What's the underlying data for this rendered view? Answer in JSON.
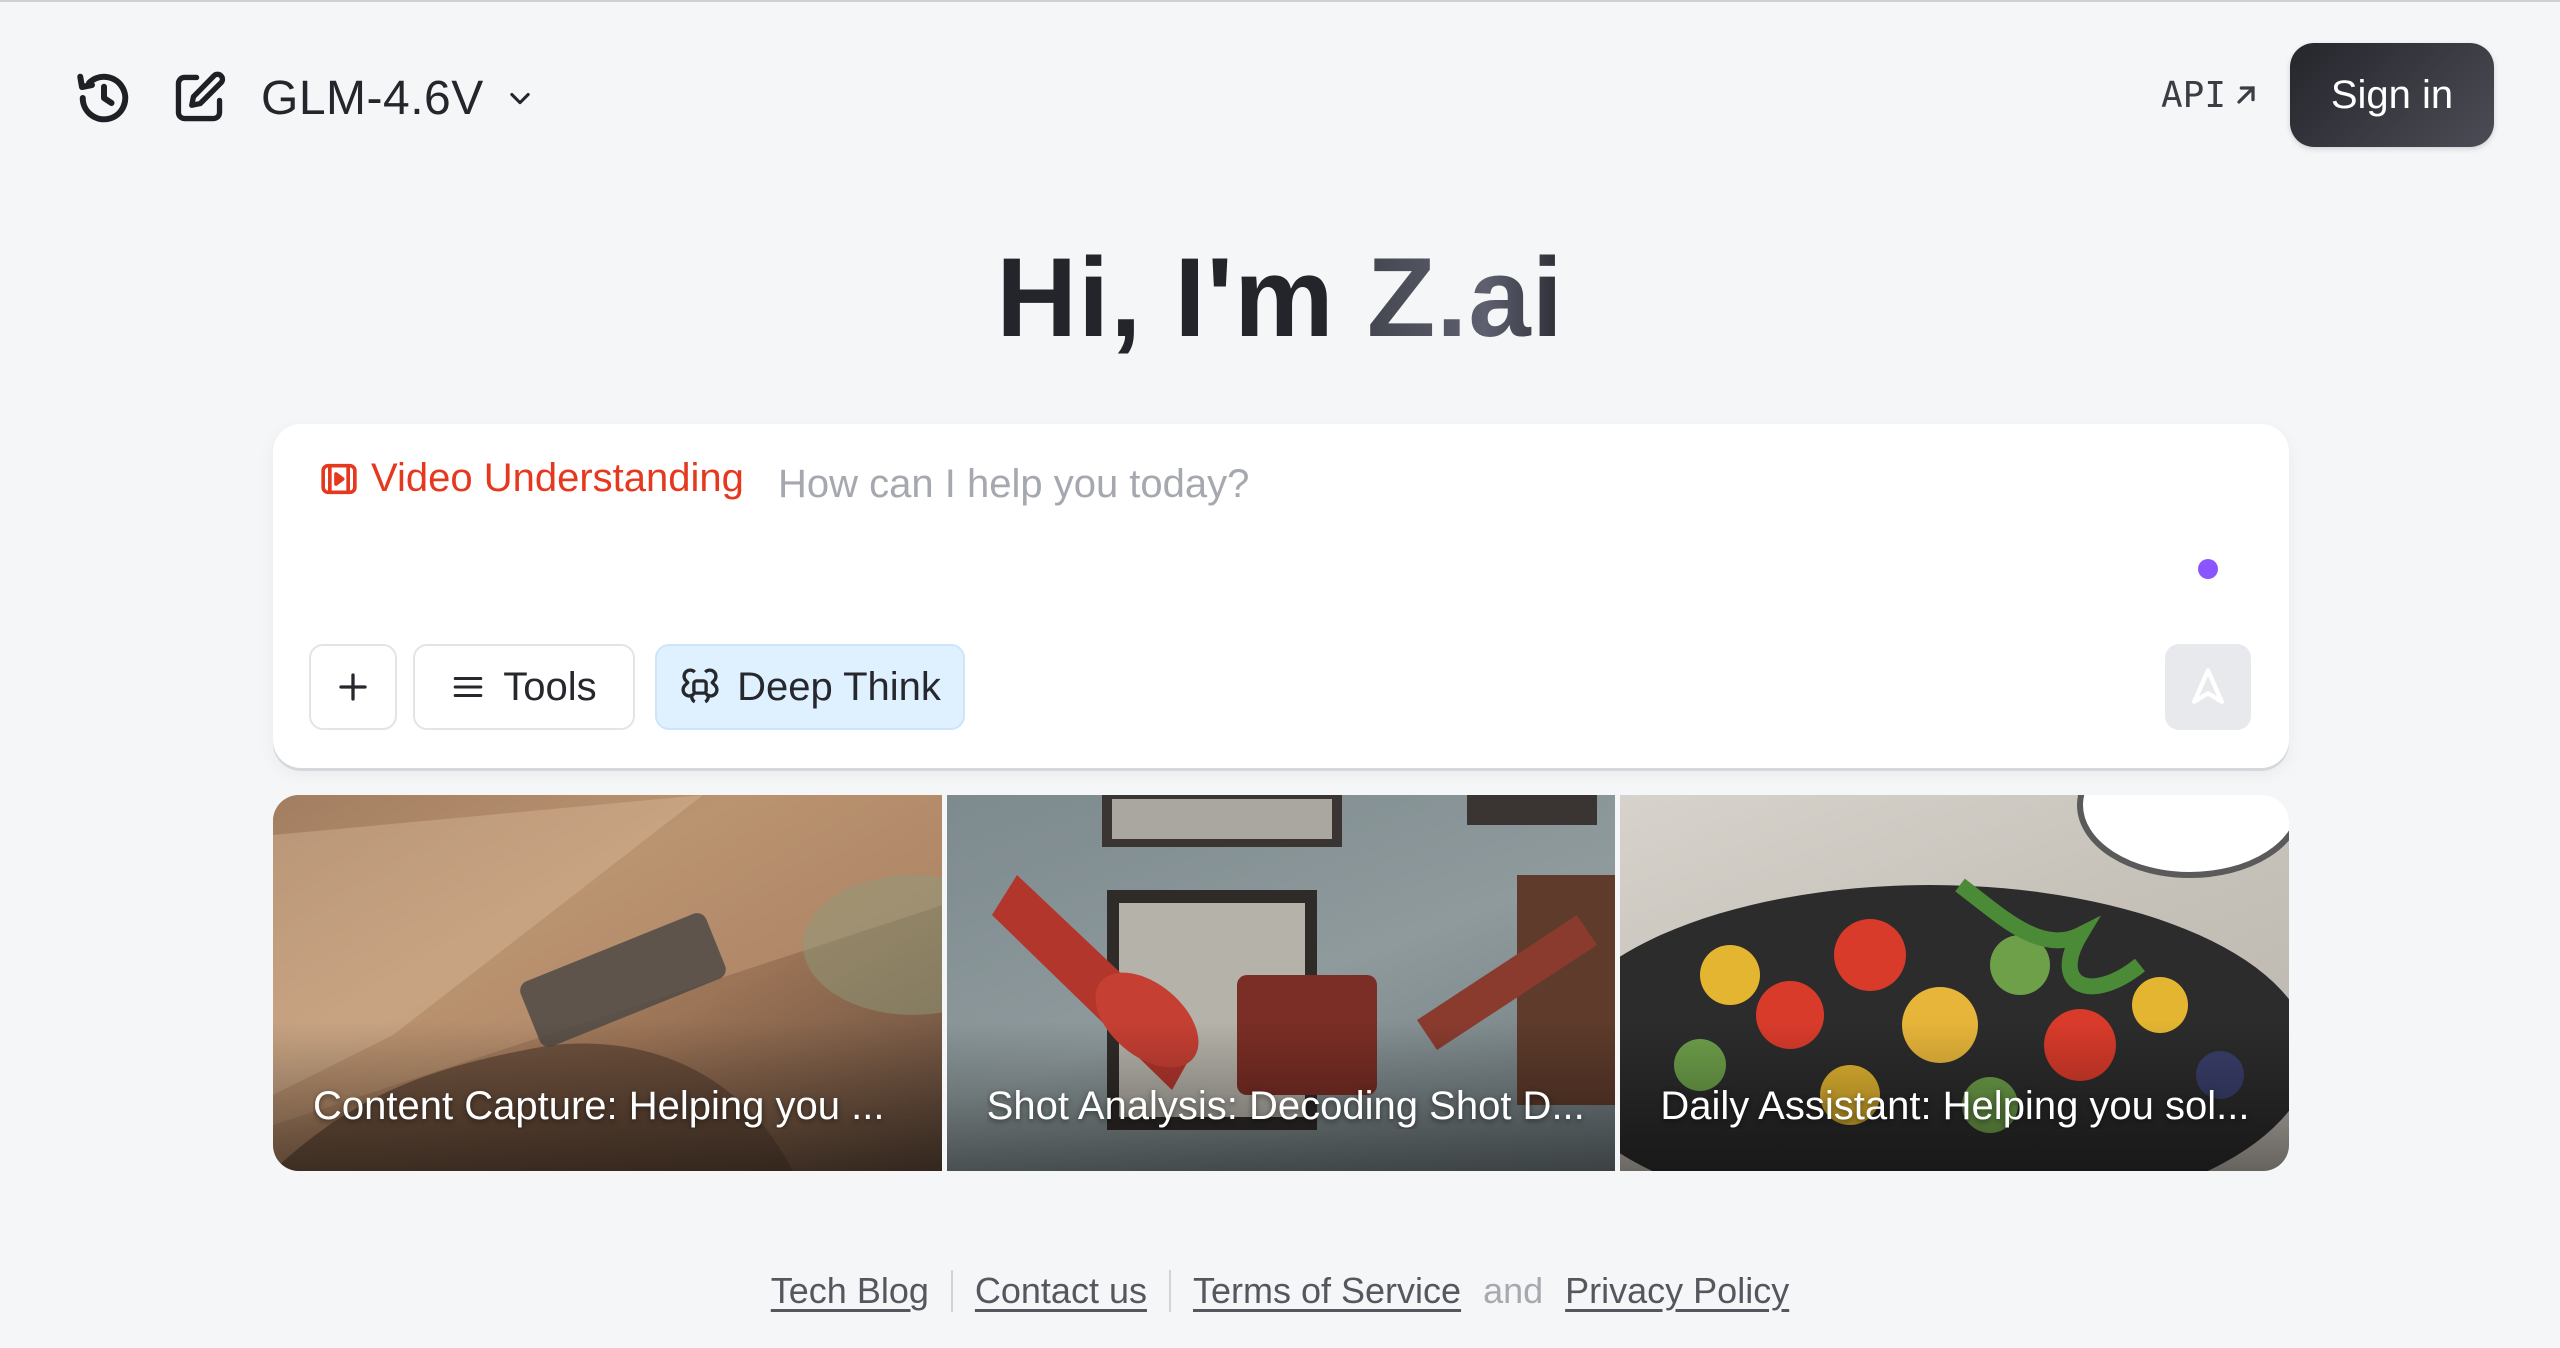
{
  "header": {
    "history_icon": "history-icon",
    "new_chat_icon": "edit-icon",
    "model_name": "GLM-4.6V",
    "api_label": "API",
    "signin_label": "Sign in"
  },
  "hero": {
    "greeting": "Hi, I'm ",
    "brand": "Z.ai"
  },
  "composer": {
    "mode_label": "Video Understanding",
    "mode_color": "#e6381e",
    "placeholder": "How can I help you today?",
    "tools_label": "Tools",
    "deep_think_label": "Deep Think",
    "status_dot_color": "#8a55ff"
  },
  "features": [
    {
      "caption": "Content Capture:  Helping you ..."
    },
    {
      "caption": "Shot Analysis: Decoding Shot D..."
    },
    {
      "caption": "Daily Assistant: Helping you sol..."
    }
  ],
  "footer": {
    "tech_blog": "Tech Blog",
    "contact": "Contact us",
    "terms": "Terms of Service",
    "and": "and",
    "privacy": "Privacy Policy"
  }
}
